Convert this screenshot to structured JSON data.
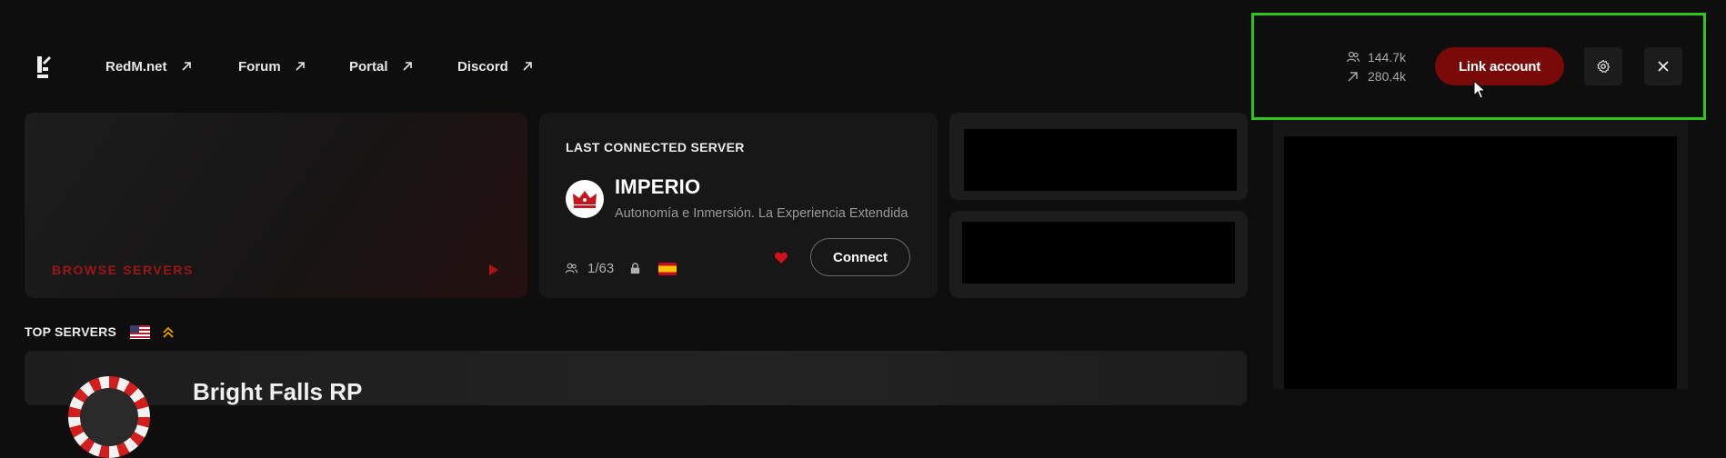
{
  "header": {
    "nav": [
      {
        "label": "RedM.net"
      },
      {
        "label": "Forum"
      },
      {
        "label": "Portal"
      },
      {
        "label": "Discord"
      }
    ],
    "stats": {
      "players": "144.7k",
      "servers": "280.4k"
    },
    "link_account_label": "Link account",
    "icons": [
      "redm-logo-icon",
      "external-link-icon",
      "players-icon",
      "arrow-up-right-icon",
      "gear-icon",
      "close-icon"
    ]
  },
  "browse": {
    "label": "BROWSE SERVERS"
  },
  "last_connected": {
    "title": "LAST CONNECTED SERVER",
    "server_name": "IMPERIO",
    "description": "Autonomía e Inmersión. La Experiencia Extendida",
    "players": "1/63",
    "connect_label": "Connect"
  },
  "top_servers": {
    "title": "TOP SERVERS",
    "first_server_name": "Bright Falls RP"
  },
  "colors": {
    "background": "#0e0e0e",
    "accent_red": "#7a0a0a",
    "browse_red": "#9e1515",
    "highlight_green": "#2ec41c"
  }
}
